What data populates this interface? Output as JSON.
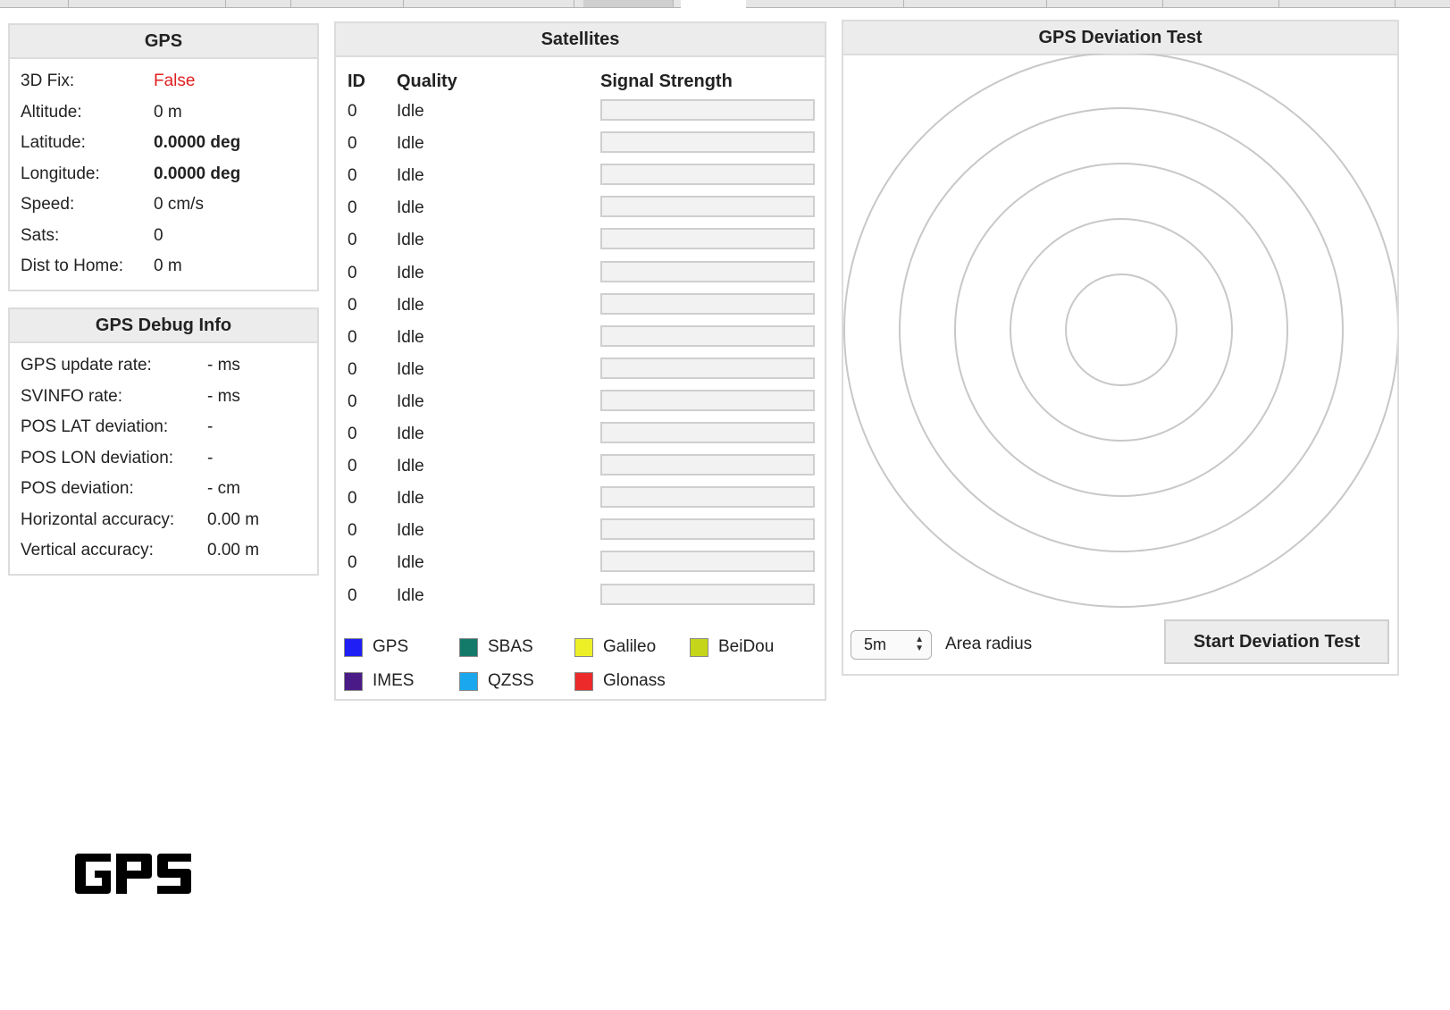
{
  "gps": {
    "title": "GPS",
    "rows": [
      {
        "label": "3D Fix:",
        "value": "False"
      },
      {
        "label": "Altitude:",
        "value": "0 m"
      },
      {
        "label": "Latitude:",
        "value": "0.0000 deg"
      },
      {
        "label": "Longitude:",
        "value": "0.0000 deg"
      },
      {
        "label": "Speed:",
        "value": "0 cm/s"
      },
      {
        "label": "Sats:",
        "value": "0"
      },
      {
        "label": "Dist to Home:",
        "value": "0 m"
      }
    ]
  },
  "debug": {
    "title": "GPS Debug Info",
    "rows": [
      {
        "label": "GPS update rate:",
        "value": "- ms"
      },
      {
        "label": "SVINFO rate:",
        "value": "- ms"
      },
      {
        "label": "POS LAT deviation:",
        "value": "-"
      },
      {
        "label": "POS LON deviation:",
        "value": "-"
      },
      {
        "label": "POS deviation:",
        "value": "- cm"
      },
      {
        "label": "Horizontal accuracy:",
        "value": "0.00 m"
      },
      {
        "label": "Vertical accuracy:",
        "value": "0.00 m"
      }
    ]
  },
  "satellites": {
    "title": "Satellites",
    "headers": {
      "id": "ID",
      "quality": "Quality",
      "signal": "Signal Strength"
    },
    "rows": [
      {
        "id": "0",
        "quality": "Idle",
        "signal": 0
      },
      {
        "id": "0",
        "quality": "Idle",
        "signal": 0
      },
      {
        "id": "0",
        "quality": "Idle",
        "signal": 0
      },
      {
        "id": "0",
        "quality": "Idle",
        "signal": 0
      },
      {
        "id": "0",
        "quality": "Idle",
        "signal": 0
      },
      {
        "id": "0",
        "quality": "Idle",
        "signal": 0
      },
      {
        "id": "0",
        "quality": "Idle",
        "signal": 0
      },
      {
        "id": "0",
        "quality": "Idle",
        "signal": 0
      },
      {
        "id": "0",
        "quality": "Idle",
        "signal": 0
      },
      {
        "id": "0",
        "quality": "Idle",
        "signal": 0
      },
      {
        "id": "0",
        "quality": "Idle",
        "signal": 0
      },
      {
        "id": "0",
        "quality": "Idle",
        "signal": 0
      },
      {
        "id": "0",
        "quality": "Idle",
        "signal": 0
      },
      {
        "id": "0",
        "quality": "Idle",
        "signal": 0
      },
      {
        "id": "0",
        "quality": "Idle",
        "signal": 0
      },
      {
        "id": "0",
        "quality": "Idle",
        "signal": 0
      }
    ],
    "legend": [
      {
        "label": "GPS",
        "color": "#1f1ff5"
      },
      {
        "label": "SBAS",
        "color": "#137a6a"
      },
      {
        "label": "Galileo",
        "color": "#eef027"
      },
      {
        "label": "BeiDou",
        "color": "#c5d61a"
      },
      {
        "label": "IMES",
        "color": "#4a1a86"
      },
      {
        "label": "QZSS",
        "color": "#1aa7ee"
      },
      {
        "label": "Glonass",
        "color": "#ec2a2a"
      }
    ]
  },
  "deviation": {
    "title": "GPS Deviation Test",
    "radius_select": "5m",
    "area_label": "Area radius",
    "start_button": "Start Deviation Test",
    "ring_count": 5
  },
  "footer": {
    "logo_text": "GPS"
  }
}
